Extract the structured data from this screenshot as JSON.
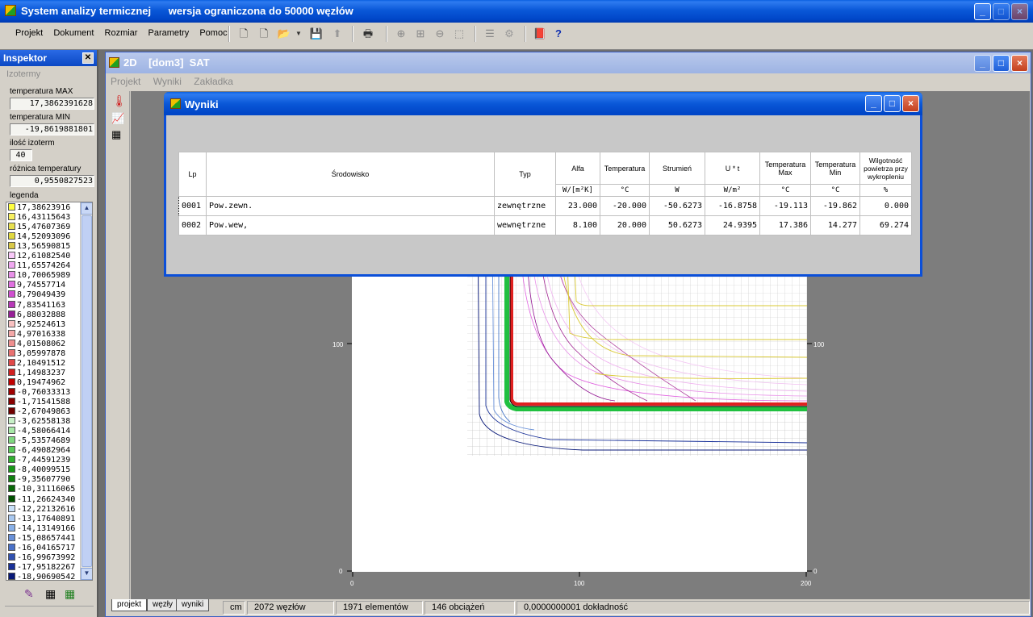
{
  "app": {
    "title": "System analizy termicznej",
    "subtitle": "wersja ograniczona do 50000 węzłów",
    "menu": [
      "Projekt",
      "Dokument",
      "Rozmiar",
      "Parametry",
      "Pomoc"
    ]
  },
  "inspector": {
    "title": "Inspektor",
    "tab": "Izotermy",
    "fields": [
      {
        "label": "temperatura MAX",
        "value": "17,3862391628"
      },
      {
        "label": "temperatura MIN",
        "value": "-19,8619881801"
      },
      {
        "label": "ilość izoterm",
        "value": "40"
      },
      {
        "label": "różnica temperatury",
        "value": "0,9550827523"
      }
    ],
    "legend_label": "legenda",
    "legend": [
      {
        "value": "17,38623916",
        "color": "#ffff40"
      },
      {
        "value": "16,43115643",
        "color": "#f8f060"
      },
      {
        "value": "15,47607369",
        "color": "#e8e050"
      },
      {
        "value": "14,52093096",
        "color": "#e0d840"
      },
      {
        "value": "13,56590815",
        "color": "#d8c848"
      },
      {
        "value": "12,61082540",
        "color": "#f8c8f8"
      },
      {
        "value": "11,65574264",
        "color": "#f0a8f0"
      },
      {
        "value": "10,70065989",
        "color": "#e890e8"
      },
      {
        "value": "9,74557714",
        "color": "#e070e0"
      },
      {
        "value": "8,79049439",
        "color": "#d050d0"
      },
      {
        "value": "7,83541163",
        "color": "#b838b8"
      },
      {
        "value": "6,88032888",
        "color": "#982098"
      },
      {
        "value": "5,92524613",
        "color": "#f8c0c0"
      },
      {
        "value": "4,97016338",
        "color": "#f4a8a8"
      },
      {
        "value": "4,01508062",
        "color": "#f09090"
      },
      {
        "value": "3,05997878",
        "color": "#e87070"
      },
      {
        "value": "2,10491512",
        "color": "#e04848"
      },
      {
        "value": "1,14983237",
        "color": "#d02020"
      },
      {
        "value": "0,19474962",
        "color": "#c00000"
      },
      {
        "value": "-0,76033313",
        "color": "#a00000"
      },
      {
        "value": "-1,71541588",
        "color": "#880000"
      },
      {
        "value": "-2,67049863",
        "color": "#700000"
      },
      {
        "value": "-3,62558138",
        "color": "#c8f0c8"
      },
      {
        "value": "-4,58066414",
        "color": "#a8e8a8"
      },
      {
        "value": "-5,53574689",
        "color": "#80d880"
      },
      {
        "value": "-6,49082964",
        "color": "#58c858"
      },
      {
        "value": "-7,44591239",
        "color": "#30b030"
      },
      {
        "value": "-8,40099515",
        "color": "#189818"
      },
      {
        "value": "-9,35607790",
        "color": "#108010"
      },
      {
        "value": "-10,31116065",
        "color": "#086808"
      },
      {
        "value": "-11,26624340",
        "color": "#005000"
      },
      {
        "value": "-12,22132616",
        "color": "#c8e0f8"
      },
      {
        "value": "-13,17640891",
        "color": "#a8c8f0"
      },
      {
        "value": "-14,13149166",
        "color": "#88b0e8"
      },
      {
        "value": "-15,08657441",
        "color": "#6890d8"
      },
      {
        "value": "-16,04165717",
        "color": "#4870c8"
      },
      {
        "value": "-16,99673992",
        "color": "#3050b0"
      },
      {
        "value": "-17,95182267",
        "color": "#183098"
      },
      {
        "value": "-18,90690542",
        "color": "#081878"
      }
    ]
  },
  "inner": {
    "title": "2D    [dom3]  SAT",
    "menu": [
      "Projekt",
      "Wyniki",
      "Zakładka"
    ]
  },
  "axes": {
    "left_100": "100",
    "left_0": "0",
    "right_100": "100",
    "right_0": "0",
    "bottom_0": "0",
    "bottom_100": "100",
    "bottom_200": "200"
  },
  "status": {
    "tabs": [
      "projekt",
      "węzły",
      "wyniki"
    ],
    "cells": [
      "cm",
      "2072 węzłów",
      "1971 elementów",
      "146 obciążeń",
      "0,0000000001 dokładność"
    ]
  },
  "wyniki": {
    "title": "Wyniki",
    "headers": [
      "Lp",
      "Środowisko",
      "Typ",
      "Alfa",
      "Temperatura",
      "Strumień",
      "U * t",
      "Temperatura Max",
      "Temperatura Min",
      "Wilgotność powietrza przy wykropleniu"
    ],
    "units": [
      "",
      "",
      "",
      "W/[m²K]",
      "°C",
      "W",
      "W/m²",
      "°C",
      "°C",
      "%"
    ],
    "rows": [
      [
        "0001",
        "Pow.zewn.",
        "zewnętrzne",
        "23.000",
        "-20.000",
        "-50.6273",
        "-16.8758",
        "-19.113",
        "-19.862",
        "0.000"
      ],
      [
        "0002",
        "Pow.wew,",
        "wewnętrzne",
        "8.100",
        "20.000",
        "50.6273",
        "24.9395",
        "17.386",
        "14.277",
        "69.274"
      ]
    ]
  }
}
